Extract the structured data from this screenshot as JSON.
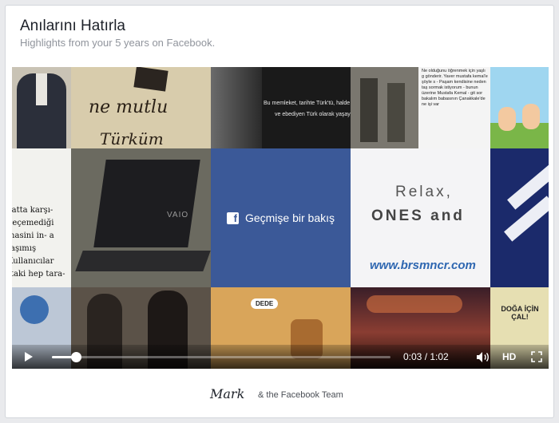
{
  "header": {
    "title": "Anılarını Hatırla",
    "subtitle": "Highlights from your 5 years on Facebook."
  },
  "video": {
    "center_label": "Geçmişe bir bakış",
    "fb_glyph": "f",
    "tiles": {
      "mutlu_text": "ne mutlu",
      "turkum_text": "Türküm",
      "quote_line1": "Bu memleket, tarihte Türk'tü, halde",
      "quote_line2": "ve ebediyen Türk olarak yaşay",
      "story_text": "Ne olduğunu öğrenmek için yaşlı g gönderir. Yaver mustafa kemal'e şöyle s - Paşam kendisine neden taş sormak istiyorum - bunun üzerine Mustafa Kemal - git sor bakalım babasının Çanakkale'de ne işi var",
      "book_text": "yatta karşı- geçemediği masini in- a taşımış Kullanıcılar ttaki hep tara-",
      "laptop_brand": "VAIO",
      "relax_line1": "Relax,",
      "relax_line2": "ONES and",
      "website": "www.brsmncr.com",
      "comic_bubble": "DEDE",
      "doga_text": "DOĞA İÇİN ÇAL!"
    },
    "controls": {
      "time_current": "0:03",
      "time_separator": " / ",
      "time_total": "1:02",
      "hd_label": "HD",
      "progress": 0.07,
      "play_icon": "play-icon",
      "volume_icon": "volume-icon",
      "fullscreen_icon": "fullscreen-icon"
    }
  },
  "footer": {
    "signature": "Mark",
    "team_text": "& the Facebook Team"
  }
}
